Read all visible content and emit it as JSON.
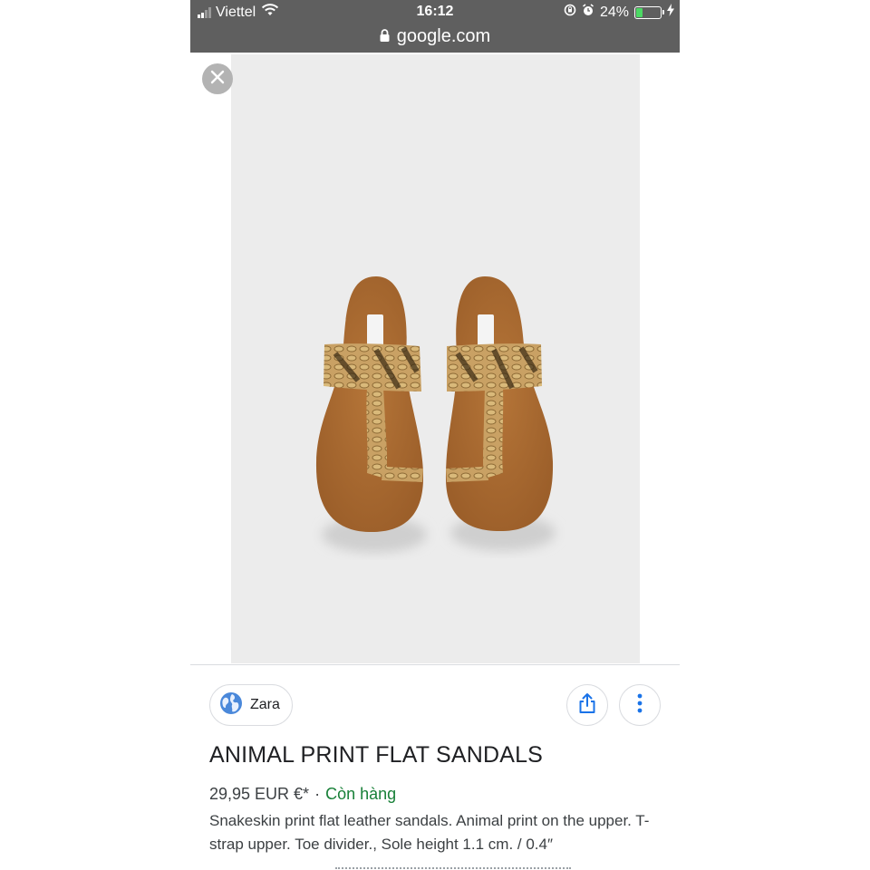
{
  "status_bar": {
    "carrier": "Viettel",
    "time": "16:12",
    "battery_percent": "24%",
    "battery_level": 0.24,
    "url": "google.com",
    "icons": [
      "signal-icon",
      "wifi-icon",
      "rotation-lock-icon",
      "alarm-icon",
      "battery-icon",
      "charging-icon",
      "lock-icon"
    ]
  },
  "viewer": {
    "close_icon": "close-icon",
    "image_alt": "Snakeskin print flat leather sandals"
  },
  "source": {
    "name": "Zara",
    "icon": "globe-icon"
  },
  "actions": {
    "share_icon": "share-icon",
    "more_icon": "more-vertical-icon"
  },
  "product": {
    "title": "ANIMAL PRINT FLAT SANDALS",
    "price": "29,95 EUR €*",
    "separator": "·",
    "availability": "Còn hàng",
    "description": "Snakeskin print flat leather sandals. Animal print on the upper. T-strap upper. Toe divider., Sole height 1.1 cm. / 0.4″"
  },
  "colors": {
    "status_bar_bg": "#5f5f5f",
    "availability_green": "#188038",
    "battery_green": "#4cd964",
    "sole_brown": "#a86a33",
    "image_bg": "#ececec"
  }
}
